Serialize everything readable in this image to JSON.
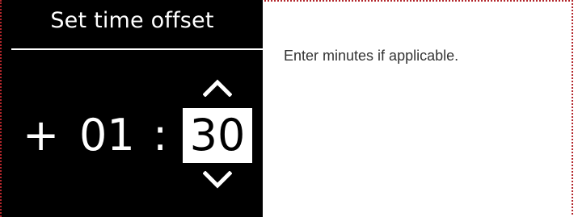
{
  "screen": {
    "title": "Set time offset",
    "sign": "+",
    "hours": "01",
    "separator": ":",
    "minutes": "30",
    "up_icon": "chevron-up-icon",
    "down_icon": "chevron-down-icon"
  },
  "instruction": {
    "text": "Enter minutes if applicable."
  },
  "colors": {
    "screen_bg": "#000000",
    "screen_text": "#ffffff",
    "highlight_bg": "#ffffff",
    "highlight_text": "#000000",
    "frame_border": "#b3262b"
  }
}
